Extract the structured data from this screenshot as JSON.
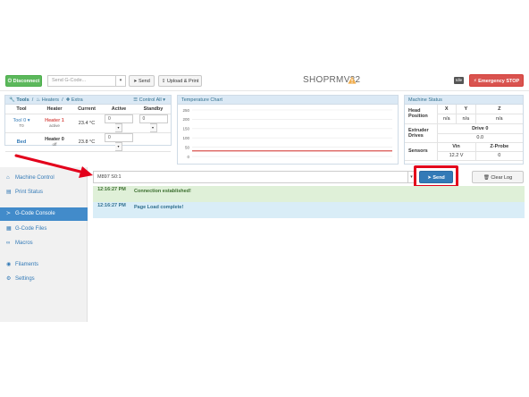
{
  "toolbar": {
    "disconnect_label": "Disconnect",
    "gcode_placeholder": "Send G-Code...",
    "send_label": "Send",
    "upload_label": "Upload & Print",
    "machine_name": "SHOPRMV32",
    "status_badge": "Idle",
    "emergency_label": "Emergency STOP"
  },
  "tools_panel": {
    "tab_tools": "Tools",
    "tab_heaters": "Heaters",
    "tab_extra": "Extra",
    "control_all": "Control All",
    "columns": [
      "Tool",
      "Heater",
      "Current",
      "Active",
      "Standby"
    ],
    "rows": [
      {
        "tool": "Tool 0",
        "tool_sub": "T0",
        "heater": "Heater 1",
        "heater_state": "active",
        "current": "23.4 °C",
        "active": "0",
        "standby": "0"
      },
      {
        "tool": "Bed",
        "tool_sub": "",
        "heater": "Heater 0",
        "heater_state": "off",
        "current": "23.8 °C",
        "active": "0",
        "standby": ""
      }
    ]
  },
  "temp_chart": {
    "title": "Temperature Chart"
  },
  "chart_data": {
    "type": "line",
    "title": "Temperature Chart",
    "xlabel": "",
    "ylabel": "",
    "y_ticks": [
      "250",
      "200",
      "150",
      "100",
      "50",
      "0"
    ],
    "ylim": [
      0,
      250
    ],
    "series": [
      {
        "values": [
          30,
          30,
          30,
          30,
          30,
          30,
          30,
          30,
          30,
          30
        ],
        "color": "#d9534f"
      }
    ],
    "grid": true
  },
  "machine_status": {
    "title": "Machine Status",
    "head_label": "Head Position",
    "axes": [
      "X",
      "Y",
      "Z"
    ],
    "axis_values": [
      "n/a",
      "n/a",
      "n/a"
    ],
    "extruder_label": "Extruder Drives",
    "drive_label": "Drive 0",
    "drive_value": "0.0",
    "sensors_label": "Sensors",
    "vin_label": "Vin",
    "vin_value": "12.2 V",
    "zprobe_label": "Z-Probe",
    "zprobe_value": "0"
  },
  "sidebar": {
    "items": [
      {
        "label": "Machine Control",
        "icon": "home-icon"
      },
      {
        "label": "Print Status",
        "icon": "print-icon"
      },
      {
        "label": "G-Code Console",
        "icon": "terminal-icon"
      },
      {
        "label": "G-Code Files",
        "icon": "files-icon"
      },
      {
        "label": "Macros",
        "icon": "link-icon"
      },
      {
        "label": "Filaments",
        "icon": "filament-icon"
      },
      {
        "label": "Settings",
        "icon": "gear-icon"
      }
    ]
  },
  "console": {
    "command_value": "M897 S0:1",
    "send_label": "Send",
    "clear_label": "Clear Log",
    "entries": [
      {
        "time": "12:16:27 PM",
        "message": "Connection established!",
        "type": "success"
      },
      {
        "time": "12:16:27 PM",
        "message": "Page Load complete!",
        "type": "info"
      }
    ]
  },
  "colors": {
    "accent": "#428bca",
    "success_bg": "#dff0d8",
    "info_bg": "#d9edf7",
    "danger": "#d9534f",
    "highlight": "#e3001b"
  }
}
